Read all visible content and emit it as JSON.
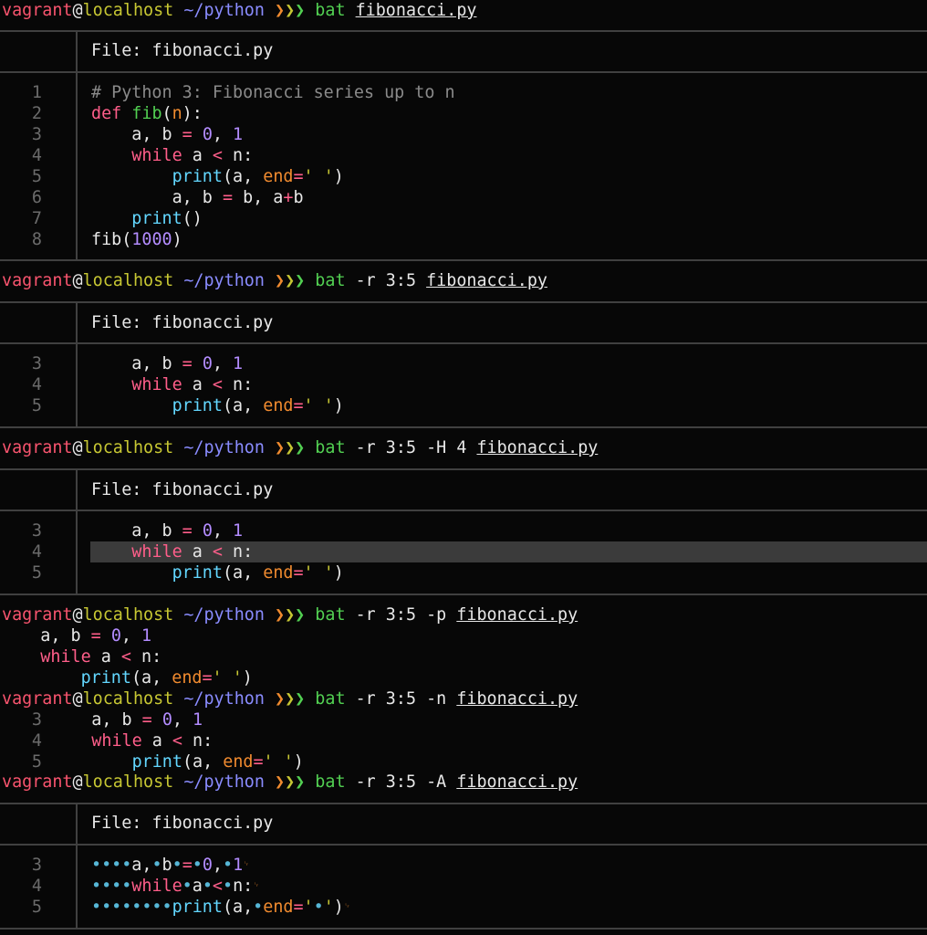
{
  "theme": {
    "prompt_user": "#f8546e",
    "prompt_host": "#c7c733",
    "prompt_path": "#8a8cff",
    "prompt_arrow_1": "#f18b2f",
    "prompt_arrow_2": "#c7c733",
    "prompt_arrow_3": "#52d052",
    "command": "#52d052",
    "keyword": "#ff5e8a",
    "number": "#b38cff",
    "builtin": "#63d7ff",
    "param": "#f18b2f",
    "comment": "#8a8a8a",
    "highlight_bg": "#3b3b3b"
  },
  "prompt": {
    "user": "vagrant",
    "at": "@",
    "host": "localhost",
    "path": "~/python",
    "arrows": "❯❯❯"
  },
  "header_label": "File:",
  "file_name": "fibonacci.py",
  "commands": [
    {
      "cmd": "bat",
      "args": "",
      "file": "fibonacci.py"
    },
    {
      "cmd": "bat",
      "args": "-r 3:5",
      "file": "fibonacci.py"
    },
    {
      "cmd": "bat",
      "args": "-r 3:5 -H 4",
      "file": "fibonacci.py"
    },
    {
      "cmd": "bat",
      "args": "-r 3:5 -p",
      "file": "fibonacci.py"
    },
    {
      "cmd": "bat",
      "args": "-r 3:5 -n",
      "file": "fibonacci.py"
    },
    {
      "cmd": "bat",
      "args": "-r 3:5 -A",
      "file": "fibonacci.py"
    }
  ],
  "source_lines": [
    {
      "n": "1",
      "text": "# Python 3: Fibonacci series up to n"
    },
    {
      "n": "2",
      "text": "def fib(n):"
    },
    {
      "n": "3",
      "text": "    a, b = 0, 1"
    },
    {
      "n": "4",
      "text": "    while a < n:"
    },
    {
      "n": "5",
      "text": "        print(a, end=' ')"
    },
    {
      "n": "6",
      "text": "        a, b = b, a+b"
    },
    {
      "n": "7",
      "text": "    print()"
    },
    {
      "n": "8",
      "text": "fib(1000)"
    }
  ],
  "highlighted_line": "4",
  "show_all": {
    "space_char": "•",
    "newline_char": "␊"
  }
}
